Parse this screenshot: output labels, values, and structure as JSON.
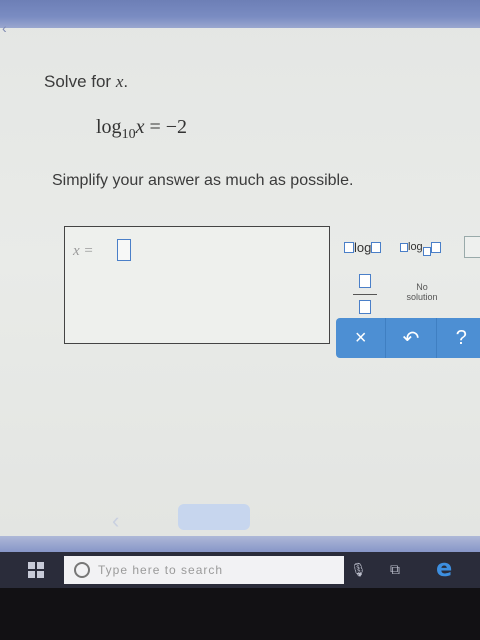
{
  "problem": {
    "prompt_prefix": "Solve for ",
    "prompt_var": "x",
    "prompt_suffix": ".",
    "eq_log": "log",
    "eq_base": "10",
    "eq_var": "x",
    "eq_rhs": " = −2",
    "instruction": "Simplify your answer as much as possible."
  },
  "answer": {
    "label": "x =",
    "value": ""
  },
  "palette": {
    "log_label": "log",
    "logbase_label": "log",
    "no_solution_line1": "No",
    "no_solution_line2": "solution",
    "actions": {
      "clear": "×",
      "undo": "↶",
      "help": "?"
    }
  },
  "taskbar": {
    "search_placeholder": "Type here to search",
    "edge": "e"
  },
  "colors": {
    "accent": "#4d8fd3",
    "input_border": "#4a7fc8"
  }
}
